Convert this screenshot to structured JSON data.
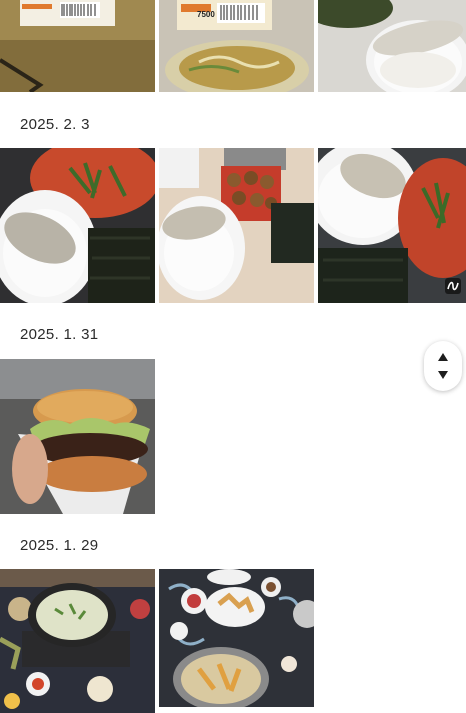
{
  "gallery": {
    "groups": [
      {
        "date": ""
      },
      {
        "date": "2025. 2. 3"
      },
      {
        "date": "2025. 1. 31"
      },
      {
        "date": "2025. 1. 29"
      }
    ],
    "top_row": {
      "price_label": "7500"
    }
  },
  "scroll_control": {
    "up_icon": "triangle-up",
    "down_icon": "triangle-down"
  },
  "colors": {
    "background": "#ffffff",
    "date_text": "#2b2b2b"
  }
}
